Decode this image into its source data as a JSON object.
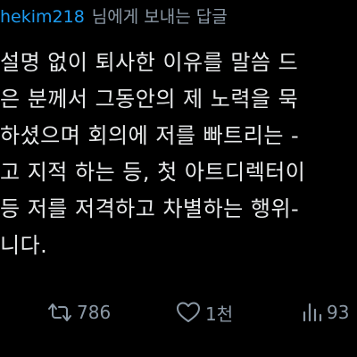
{
  "reply": {
    "username": "hekim218",
    "suffix": "님에게 보내는 답글"
  },
  "body_lines": [
    "설명 없이 퇴사한 이유를 말씀 드",
    "은 분께서 그동안의 제 노력을 묵",
    "하셨으며 회의에 저를 빠트리는 -",
    "고 지적 하는 등, 첫 아트디렉터이",
    "등 저를 저격하고 차별하는 행위-",
    "니다."
  ],
  "actions": {
    "retweets": "786",
    "likes": "1천",
    "views": "93"
  },
  "icons": {
    "retweet": "retweet-icon",
    "like": "heart-icon",
    "views": "views-icon"
  },
  "colors": {
    "background": "#000000",
    "text": "#e7e9ea",
    "muted": "#8b98a5",
    "link": "#1d9bf0"
  }
}
